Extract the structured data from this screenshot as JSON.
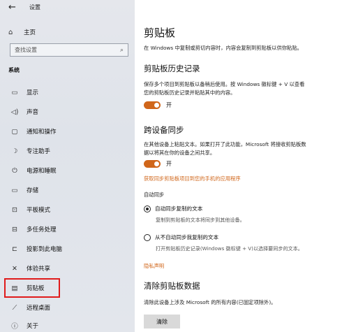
{
  "titlebar": {
    "back_icon": "←",
    "title": "设置"
  },
  "sidebar": {
    "home_icon": "⌂",
    "home_label": "主页",
    "search_placeholder": "查找设置",
    "search_icon": "⌕",
    "section": "系统",
    "items": [
      {
        "icon": "▭",
        "label": "显示"
      },
      {
        "icon": "◁)",
        "label": "声音"
      },
      {
        "icon": "▢",
        "label": "通知和操作"
      },
      {
        "icon": "☽",
        "label": "专注助手"
      },
      {
        "icon": "⏻",
        "label": "电源和睡眠"
      },
      {
        "icon": "▭",
        "label": "存储"
      },
      {
        "icon": "⊡",
        "label": "平板模式"
      },
      {
        "icon": "⊟",
        "label": "多任务处理"
      },
      {
        "icon": "⊏",
        "label": "投影到此电脑"
      },
      {
        "icon": "✕",
        "label": "体验共享"
      },
      {
        "icon": "▤",
        "label": "剪贴板"
      },
      {
        "icon": "⟋",
        "label": "远程桌面"
      },
      {
        "icon": "ⓘ",
        "label": "关于"
      }
    ]
  },
  "main": {
    "title": "剪贴板",
    "intro": "在 Windows 中复制或剪切内容时，内容会复制到剪贴板以供你粘贴。",
    "history": {
      "heading": "剪贴板历史记录",
      "desc1": "保存多个项目到剪贴板以备稍后使用。按 Windows 徽标键 + V 以查看",
      "desc2": "您的剪贴板历史记录并粘贴其中的内容。",
      "toggle_state": "开"
    },
    "sync": {
      "heading": "跨设备同步",
      "desc1": "在其他设备上粘贴文本。如果打开了此功能，Microsoft 将接收剪贴板数",
      "desc2": "据以将其在你的设备之间共享。",
      "toggle_state": "开",
      "link": "获取同步剪贴板项目到您的手机的应用程序",
      "auto_label": "自动同步",
      "option1": "自动同步复制的文本",
      "option1_desc": "复制到剪贴板的文本将同步到其他设备。",
      "option2": "从不自动同步我复制的文本",
      "option2_desc": "打开剪贴板历史记录(Windows 徽标键 + V)以选择要同步的文本。"
    },
    "privacy_link": "隐私声明",
    "clear": {
      "heading": "清除剪贴板数据",
      "desc": "清除此设备上涉及 Microsoft 的所有内容(已固定项除外)。",
      "button": "清除"
    }
  }
}
